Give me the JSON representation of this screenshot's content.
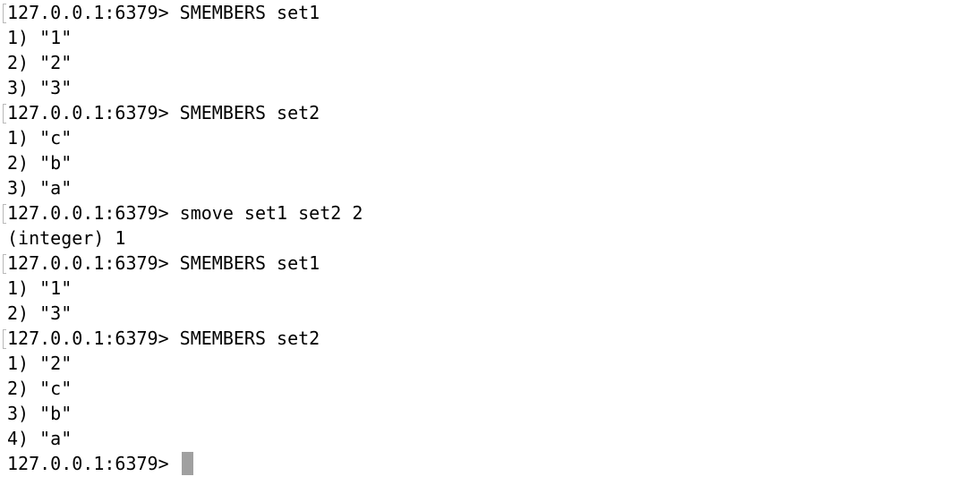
{
  "terminal": {
    "prompt": "127.0.0.1:6379> ",
    "lines": [
      {
        "kind": "command",
        "text": "127.0.0.1:6379> SMEMBERS set1"
      },
      {
        "kind": "output",
        "text": "1) \"1\""
      },
      {
        "kind": "output",
        "text": "2) \"2\""
      },
      {
        "kind": "output",
        "text": "3) \"3\""
      },
      {
        "kind": "command",
        "text": "127.0.0.1:6379> SMEMBERS set2"
      },
      {
        "kind": "output",
        "text": "1) \"c\""
      },
      {
        "kind": "output",
        "text": "2) \"b\""
      },
      {
        "kind": "output",
        "text": "3) \"a\""
      },
      {
        "kind": "command",
        "text": "127.0.0.1:6379> smove set1 set2 2"
      },
      {
        "kind": "output",
        "text": "(integer) 1"
      },
      {
        "kind": "command",
        "text": "127.0.0.1:6379> SMEMBERS set1"
      },
      {
        "kind": "output",
        "text": "1) \"1\""
      },
      {
        "kind": "output",
        "text": "2) \"3\""
      },
      {
        "kind": "command",
        "text": "127.0.0.1:6379> SMEMBERS set2"
      },
      {
        "kind": "output",
        "text": "1) \"2\""
      },
      {
        "kind": "output",
        "text": "2) \"c\""
      },
      {
        "kind": "output",
        "text": "3) \"b\""
      },
      {
        "kind": "output",
        "text": "4) \"a\""
      }
    ],
    "colors": {
      "background": "#ffffff",
      "text": "#000000",
      "cursor": "#a0a0a0",
      "mark": "#b8b8b8"
    }
  }
}
